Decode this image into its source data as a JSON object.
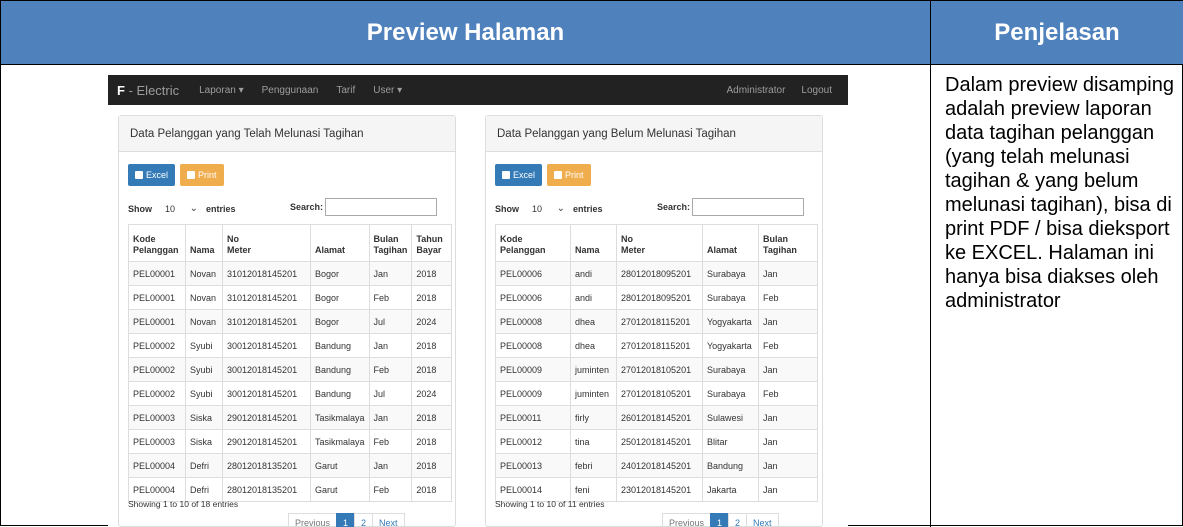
{
  "doc": {
    "header_left": "Preview Halaman",
    "header_right": "Penjelasan",
    "explanation": "Dalam preview disamping adalah preview laporan data tagihan pelanggan (yang telah melunasi tagihan & yang belum melunasi tagihan), bisa di print PDF / bisa dieksport ke EXCEL. Halaman ini hanya bisa diakses oleh administrator"
  },
  "navbar": {
    "brand_bold": "F",
    "brand_rest": " - Electric",
    "items": [
      "Laporan ▾",
      "Penggunaan",
      "Tarif",
      "User ▾"
    ],
    "right_items": [
      "Administrator",
      "Logout"
    ]
  },
  "panels": [
    {
      "title": "Data Pelanggan yang Telah Melunasi Tagihan",
      "excel_label": "Excel",
      "print_label": "Print",
      "show_label": "Show",
      "entries_value": "10",
      "entries_label": "entries",
      "search_label": "Search:",
      "columns": [
        "Kode Pelanggan",
        "Nama",
        "No Meter",
        "Alamat",
        "Bulan Tagihan",
        "Tahun Bayar"
      ],
      "rows": [
        [
          "PEL00001",
          "Novan",
          "31012018145201",
          "Bogor",
          "Jan",
          "2018"
        ],
        [
          "PEL00001",
          "Novan",
          "31012018145201",
          "Bogor",
          "Feb",
          "2018"
        ],
        [
          "PEL00001",
          "Novan",
          "31012018145201",
          "Bogor",
          "Jul",
          "2024"
        ],
        [
          "PEL00002",
          "Syubi",
          "30012018145201",
          "Bandung",
          "Jan",
          "2018"
        ],
        [
          "PEL00002",
          "Syubi",
          "30012018145201",
          "Bandung",
          "Feb",
          "2018"
        ],
        [
          "PEL00002",
          "Syubi",
          "30012018145201",
          "Bandung",
          "Jul",
          "2024"
        ],
        [
          "PEL00003",
          "Siska",
          "29012018145201",
          "Tasikmalaya",
          "Jan",
          "2018"
        ],
        [
          "PEL00003",
          "Siska",
          "29012018145201",
          "Tasikmalaya",
          "Feb",
          "2018"
        ],
        [
          "PEL00004",
          "Defri",
          "28012018135201",
          "Garut",
          "Jan",
          "2018"
        ],
        [
          "PEL00004",
          "Defri",
          "28012018135201",
          "Garut",
          "Feb",
          "2018"
        ]
      ],
      "info": "Showing 1 to 10 of 18 entries",
      "pager": [
        "Previous",
        "1",
        "2",
        "Next"
      ]
    },
    {
      "title": "Data Pelanggan yang Belum Melunasi Tagihan",
      "excel_label": "Excel",
      "print_label": "Print",
      "show_label": "Show",
      "entries_value": "10",
      "entries_label": "entries",
      "search_label": "Search:",
      "columns": [
        "Kode Pelanggan",
        "Nama",
        "No Meter",
        "Alamat",
        "Bulan Tagihan"
      ],
      "rows": [
        [
          "PEL00006",
          "andi",
          "28012018095201",
          "Surabaya",
          "Jan"
        ],
        [
          "PEL00006",
          "andi",
          "28012018095201",
          "Surabaya",
          "Feb"
        ],
        [
          "PEL00008",
          "dhea",
          "27012018115201",
          "Yogyakarta",
          "Jan"
        ],
        [
          "PEL00008",
          "dhea",
          "27012018115201",
          "Yogyakarta",
          "Feb"
        ],
        [
          "PEL00009",
          "juminten",
          "27012018105201",
          "Surabaya",
          "Jan"
        ],
        [
          "PEL00009",
          "juminten",
          "27012018105201",
          "Surabaya",
          "Feb"
        ],
        [
          "PEL00011",
          "firly",
          "26012018145201",
          "Sulawesi",
          "Jan"
        ],
        [
          "PEL00012",
          "tina",
          "25012018145201",
          "Blitar",
          "Jan"
        ],
        [
          "PEL00013",
          "febri",
          "24012018145201",
          "Bandung",
          "Jan"
        ],
        [
          "PEL00014",
          "feni",
          "23012018145201",
          "Jakarta",
          "Jan"
        ]
      ],
      "info": "Showing 1 to 10 of 11 entries",
      "pager": [
        "Previous",
        "1",
        "2",
        "Next"
      ]
    }
  ]
}
